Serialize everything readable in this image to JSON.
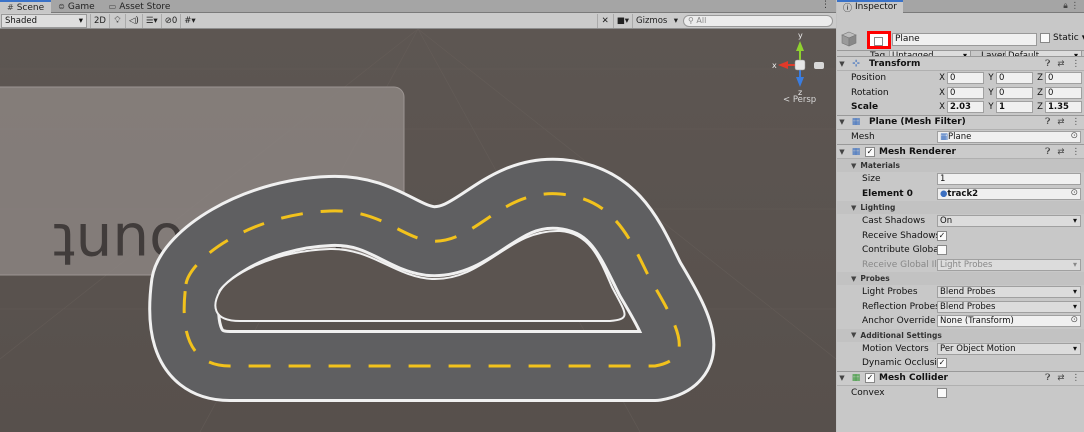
{
  "scene": {
    "tabs": [
      {
        "icon": "grid-icon",
        "label": "Scene"
      },
      {
        "icon": "gamepad-icon",
        "label": "Game"
      },
      {
        "icon": "store-icon",
        "label": "Asset Store"
      }
    ],
    "toolbar": {
      "shading_mode": "Shaded",
      "mode_2d": "2D",
      "hidden_count": "0",
      "gizmos_label": "Gizmos",
      "search_placeholder": "All"
    },
    "viewport": {
      "background_text": "Log Count",
      "persp_label": "< Persp",
      "gizmo_axes": {
        "x": "x",
        "y": "y",
        "z": "z"
      }
    }
  },
  "inspector": {
    "tab_label": "Inspector",
    "object_name": "Plane",
    "static_label": "Static",
    "tag_label": "Tag",
    "tag_value": "Untagged",
    "layer_label": "Layer",
    "layer_value": "Default",
    "transform": {
      "title": "Transform",
      "position": {
        "label": "Position",
        "x": "0",
        "y": "0",
        "z": "0"
      },
      "rotation": {
        "label": "Rotation",
        "x": "0",
        "y": "0",
        "z": "0"
      },
      "scale": {
        "label": "Scale",
        "x": "2.03",
        "y": "1",
        "z": "1.35"
      }
    },
    "mesh_filter": {
      "title": "Plane (Mesh Filter)",
      "mesh_label": "Mesh",
      "mesh_value": "Plane"
    },
    "mesh_renderer": {
      "title": "Mesh Renderer",
      "materials_header": "Materials",
      "size_label": "Size",
      "size_value": "1",
      "element0_label": "Element 0",
      "element0_value": "track2",
      "lighting_header": "Lighting",
      "cast_shadows_label": "Cast Shadows",
      "cast_shadows_value": "On",
      "receive_shadows_label": "Receive Shadows",
      "contribute_gi_label": "Contribute Global I",
      "receive_gi_label": "Receive Global Illu",
      "receive_gi_value": "Light Probes",
      "probes_header": "Probes",
      "light_probes_label": "Light Probes",
      "light_probes_value": "Blend Probes",
      "reflection_probes_label": "Reflection Probes",
      "reflection_probes_value": "Blend Probes",
      "anchor_override_label": "Anchor Override",
      "anchor_override_value": "None (Transform)",
      "additional_header": "Additional Settings",
      "motion_vectors_label": "Motion Vectors",
      "motion_vectors_value": "Per Object Motion",
      "dynamic_occlusion_label": "Dynamic Occlusio"
    },
    "mesh_collider": {
      "title": "Mesh Collider",
      "convex_label": "Convex"
    }
  },
  "colors": {
    "scene_bg": "#5b5450",
    "road": "#5e5e60",
    "road_edge": "#e8e8e8",
    "lane_marking": "#f2c21c",
    "highlight": "#ff0000",
    "accent": "#3a72c8"
  }
}
